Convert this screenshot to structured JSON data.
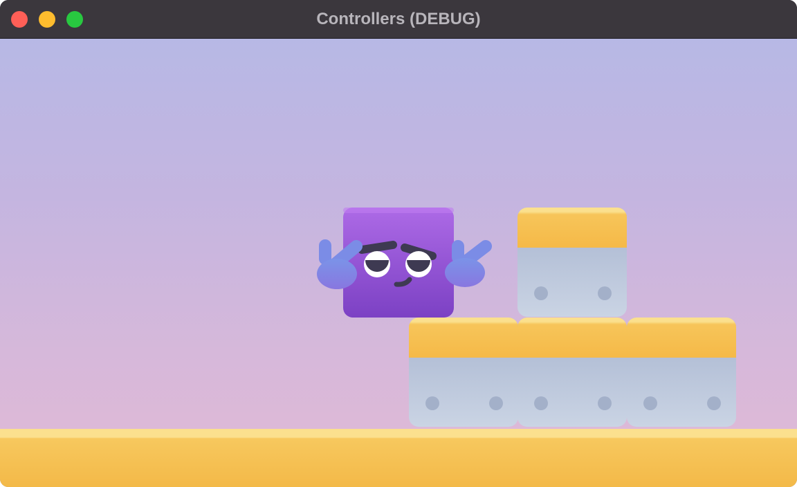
{
  "window": {
    "title": "Controllers (DEBUG)"
  },
  "colors": {
    "sky_top": "#b7b8e5",
    "sky_bottom": "#e2bad6",
    "ground": "#f5b947",
    "player": "#9b56dc",
    "block_cap": "#f7c55a",
    "block_body": "#b9c4da"
  }
}
